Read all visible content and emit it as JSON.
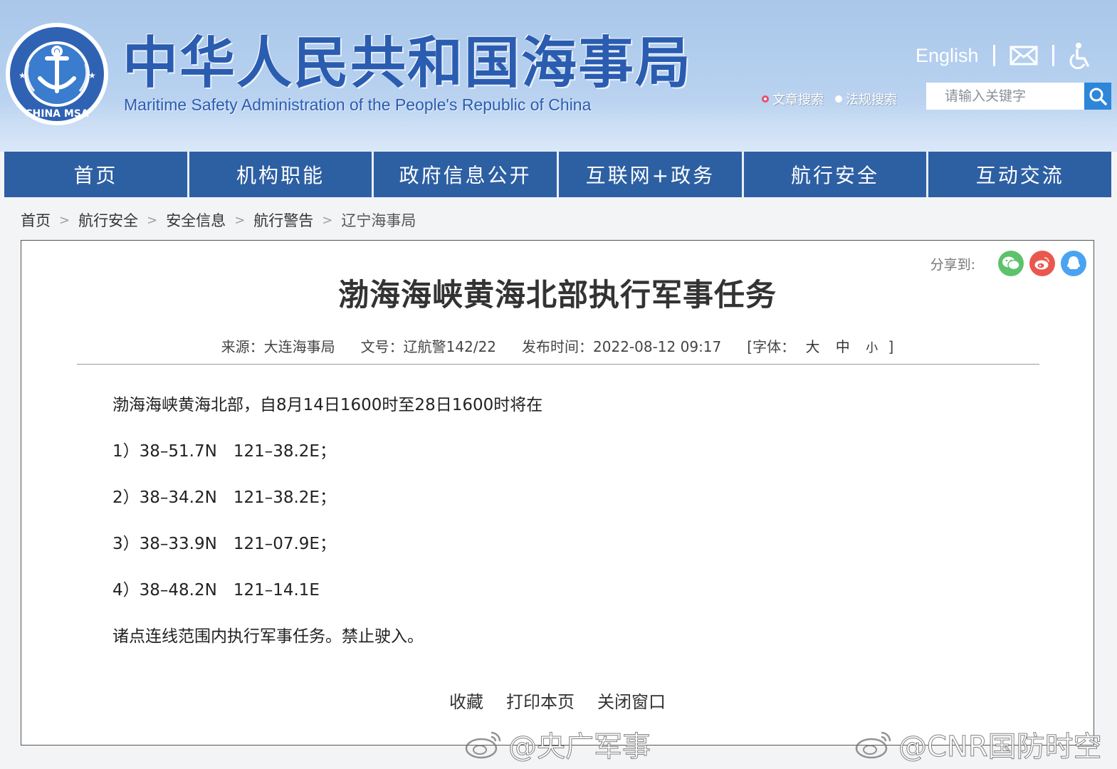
{
  "header": {
    "title": "中华人民共和国海事局",
    "subtitle": "Maritime Safety Administration of the People's Republic of China",
    "logo_text": "CHINA MSA",
    "english_link": "English",
    "search_options": [
      {
        "label": "文章搜索",
        "selected": true
      },
      {
        "label": "法规搜索",
        "selected": false
      }
    ],
    "search_placeholder": "请输入关键字",
    "icons": [
      "mail-icon",
      "accessibility-icon",
      "search-icon"
    ]
  },
  "nav": {
    "items": [
      "首页",
      "机构职能",
      "政府信息公开",
      "互联网+政务",
      "航行安全",
      "互动交流"
    ]
  },
  "breadcrumb": [
    "首页",
    "航行安全",
    "安全信息",
    "航行警告",
    "辽宁海事局"
  ],
  "article": {
    "share_label": "分享到:",
    "share_icons": [
      "wechat-icon",
      "weibo-icon",
      "qq-icon"
    ],
    "title": "渤海海峡黄海北部执行军事任务",
    "meta": {
      "source": "来源：大连海事局",
      "doc_no": "文号：辽航警142/22",
      "published": "发布时间：2022-08-12 09:17",
      "font_label": "[字体：",
      "font_sizes": [
        "大",
        "中",
        "小"
      ],
      "font_close": "]"
    },
    "paragraphs": [
      "渤海海峡黄海北部，自8月14日1600时至28日1600时将在",
      "1）38–51.7N　121–38.2E；",
      "2）38–34.2N　121–38.2E；",
      "3）38–33.9N　121–07.9E；",
      "4）38–48.2N　121–14.1E",
      "诸点连线范围内执行军事任务。禁止驶入。"
    ],
    "actions": [
      "收藏",
      "打印本页",
      "关闭窗口"
    ]
  },
  "watermarks": [
    "@央广军事",
    "@CNR国防时空"
  ],
  "colors": {
    "brand_blue": "#2a5cb0",
    "nav_blue": "#2d5fa3",
    "search_button": "#2e86d8",
    "wechat": "#5cc36a",
    "weibo": "#e9574f",
    "qq": "#4aa3f0"
  }
}
